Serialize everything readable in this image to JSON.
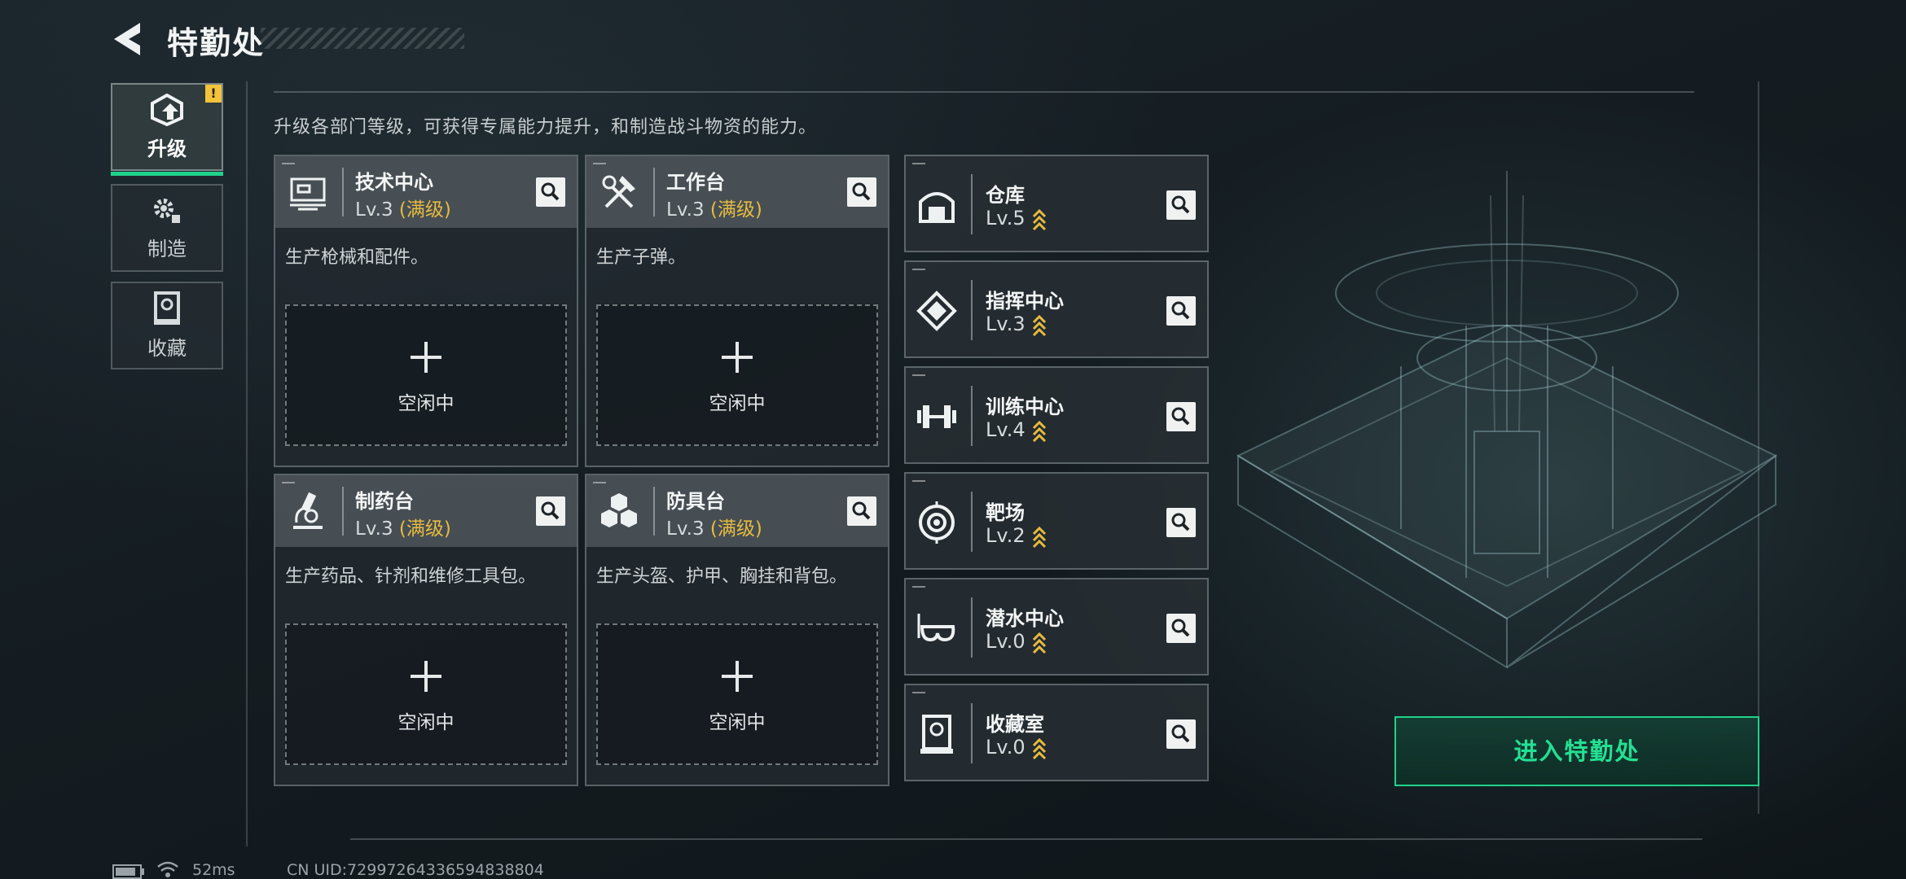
{
  "header": {
    "title": "特勤处"
  },
  "nav": {
    "upgrade_label": "升级",
    "upgrade_alert": "!",
    "craft_label": "制造",
    "collection_label": "收藏"
  },
  "description": "升级各部门等级，可获得专属能力提升，和制造战斗物资的能力。",
  "cards": [
    {
      "name": "技术中心",
      "level": "Lv.3",
      "max": "(满级)",
      "desc": "生产枪械和配件。",
      "slot": "空闲中",
      "icon": "computer-terminal-icon"
    },
    {
      "name": "工作台",
      "level": "Lv.3",
      "max": "(满级)",
      "desc": "生产子弹。",
      "slot": "空闲中",
      "icon": "tools-icon"
    },
    {
      "name": "制药台",
      "level": "Lv.3",
      "max": "(满级)",
      "desc": "生产药品、针剂和维修工具包。",
      "slot": "空闲中",
      "icon": "microscope-icon"
    },
    {
      "name": "防具台",
      "level": "Lv.3",
      "max": "(满级)",
      "desc": "生产头盔、护甲、胸挂和背包。",
      "slot": "空闲中",
      "icon": "armor-boxes-icon"
    }
  ],
  "rows": [
    {
      "name": "仓库",
      "level": "Lv.5",
      "icon": "warehouse-icon"
    },
    {
      "name": "指挥中心",
      "level": "Lv.3",
      "icon": "chip-icon"
    },
    {
      "name": "训练中心",
      "level": "Lv.4",
      "icon": "dumbbell-icon"
    },
    {
      "name": "靶场",
      "level": "Lv.2",
      "icon": "target-icon"
    },
    {
      "name": "潜水中心",
      "level": "Lv.0",
      "icon": "diving-mask-icon"
    },
    {
      "name": "收藏室",
      "level": "Lv.0",
      "icon": "display-case-icon"
    }
  ],
  "enter_button": "进入特勤处",
  "status": {
    "ping": "52ms",
    "uid": "CN UID:72997264336594838804"
  },
  "colors": {
    "accent_green": "#20d28b",
    "max_gold": "#e6bb3f",
    "alert_yellow": "#f3c33b"
  }
}
